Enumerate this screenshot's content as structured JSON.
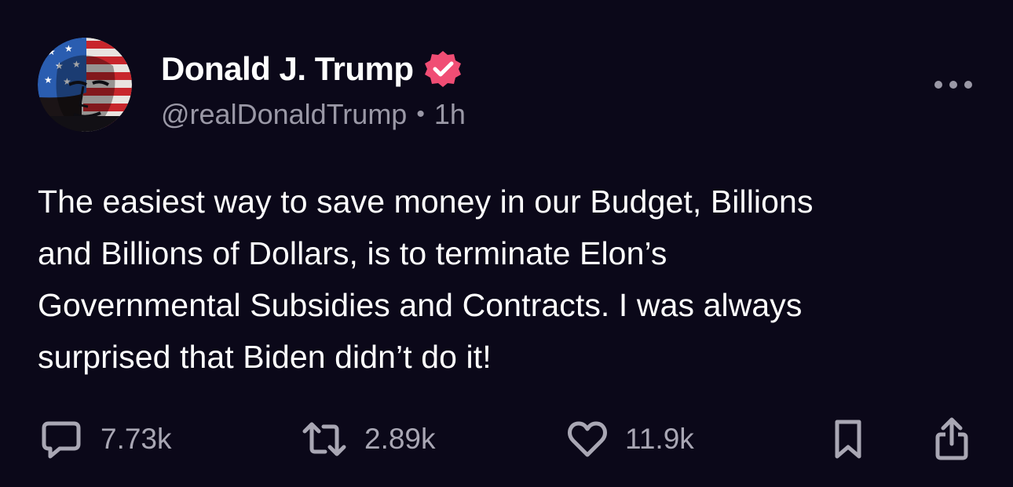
{
  "post": {
    "author": {
      "display_name": "Donald J. Trump",
      "handle": "@realDonaldTrump",
      "separator": "•",
      "time": "1h",
      "verified": true,
      "verified_badge_color": "#f04d74",
      "avatar_icon": "flag-portrait-avatar"
    },
    "body_lines": [
      "The easiest way to save money in our Budget, Billions",
      "and Billions of Dollars, is to terminate Elon’s",
      "Governmental Subsidies and Contracts. I was always",
      "surprised that Biden didn’t do it!"
    ],
    "actions": {
      "reply": {
        "icon": "reply-icon",
        "count": "7.73k"
      },
      "repost": {
        "icon": "repost-icon",
        "count": "2.89k"
      },
      "like": {
        "icon": "heart-icon",
        "count": "11.9k"
      },
      "bookmark": {
        "icon": "bookmark-icon"
      },
      "share": {
        "icon": "share-icon"
      }
    },
    "more_icon": "more-horizontal-icon"
  },
  "colors": {
    "background": "#0b0819",
    "text_primary": "#ffffff",
    "text_secondary": "#9a98a6",
    "icon": "#a9a7b4"
  }
}
